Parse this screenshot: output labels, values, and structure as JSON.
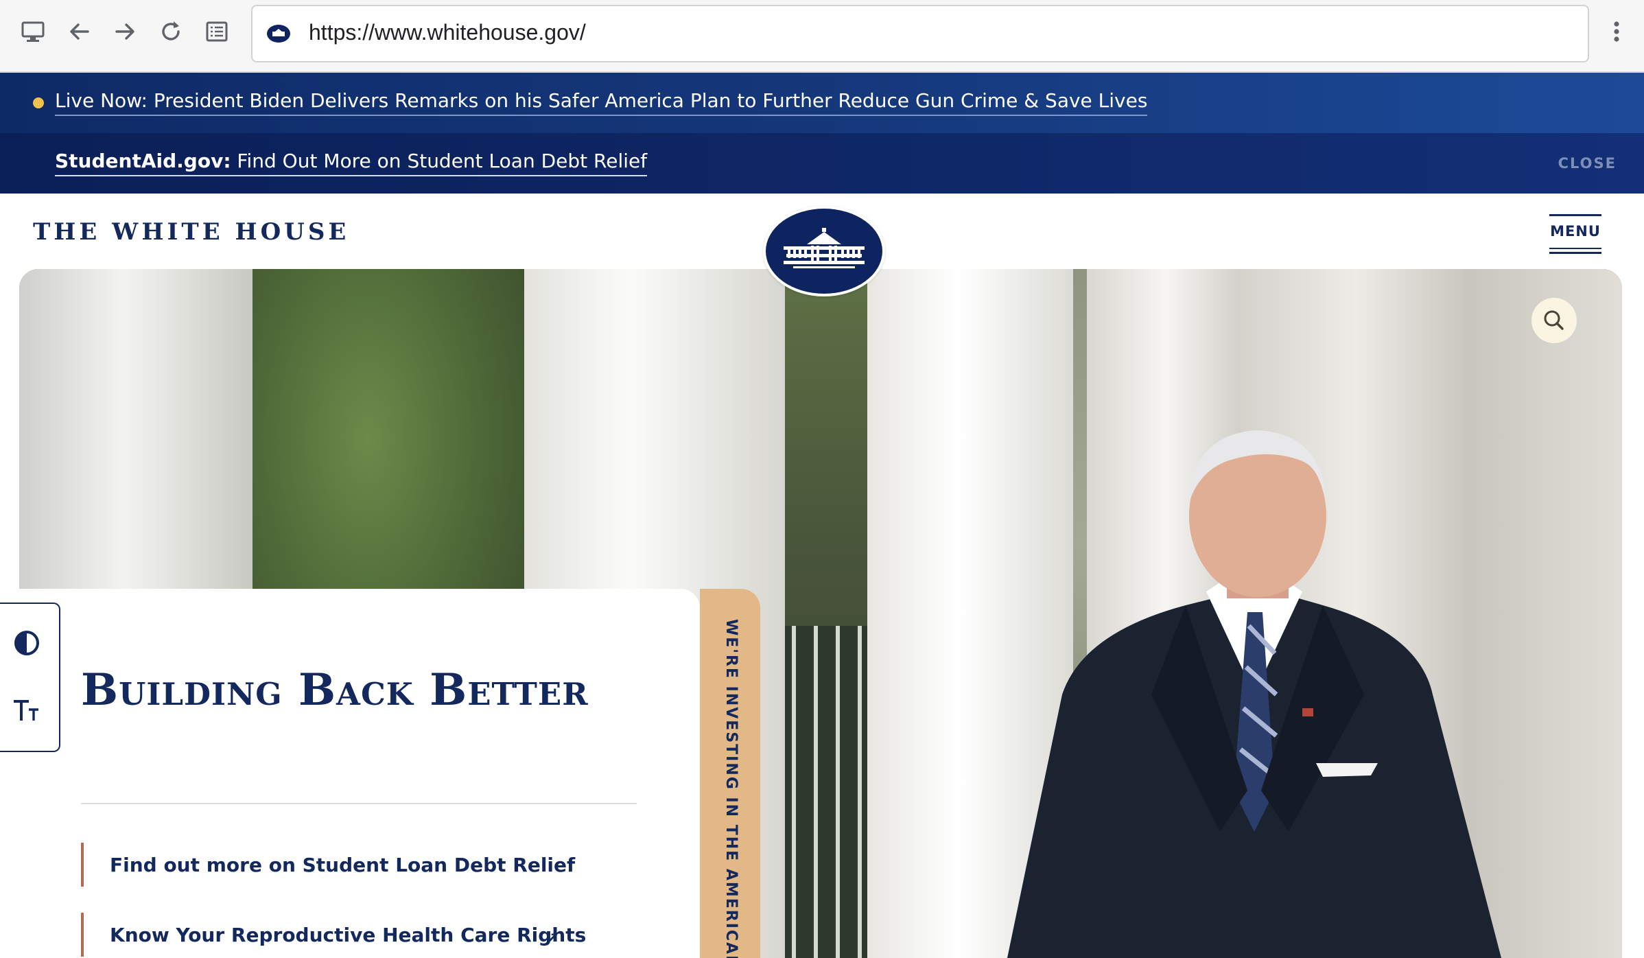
{
  "browser": {
    "url": "https://www.whitehouse.gov/",
    "icons": [
      "monitor-icon",
      "back-arrow-icon",
      "forward-arrow-icon",
      "reload-icon",
      "reader-mode-icon",
      "favicon-icon",
      "kebab-menu-icon"
    ]
  },
  "alerts": {
    "live": {
      "label": "Live Now: President Biden Delivers Remarks on his Safer America Plan to Further Reduce Gun Crime & Save Lives",
      "dot_color": "#f2c14e"
    },
    "student": {
      "prefix": "StudentAid.gov:",
      "label": " Find Out More on Student Loan Debt Relief",
      "close_label": "CLOSE"
    }
  },
  "header": {
    "site_title": "THE WHITE HOUSE",
    "menu_label": "MENU"
  },
  "hero": {
    "heading": "Building Back Better",
    "vertical_text": "WE'RE INVESTING IN THE AMERICAN PE",
    "links": [
      {
        "label": "Find out more on Student Loan Debt Relief",
        "external": false
      },
      {
        "label": "Know Your Reproductive Health Care Rights",
        "external": true,
        "arrow": "↗"
      }
    ]
  },
  "accessibility": {
    "icons": [
      "contrast-icon",
      "text-size-icon"
    ]
  },
  "colors": {
    "navy": "#13295e",
    "accent_tan": "#e2b887",
    "link_border": "#b06a55"
  }
}
